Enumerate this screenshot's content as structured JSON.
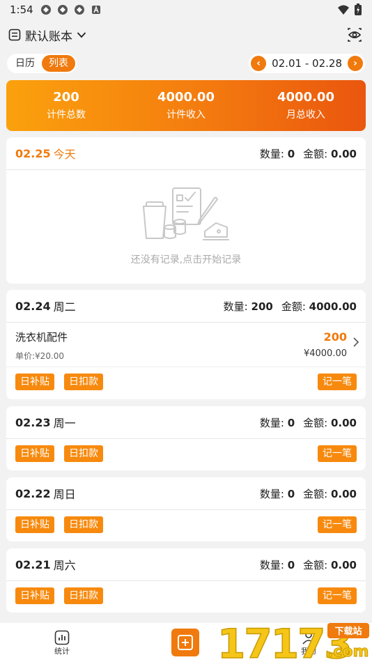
{
  "status_bar": {
    "time": "1:54"
  },
  "header": {
    "ledger_name": "默认账本"
  },
  "view_toggle": {
    "calendar": "日历",
    "list": "列表"
  },
  "range": {
    "label": "02.01 - 02.28"
  },
  "summary": [
    {
      "value": "200",
      "caption": "计件总数"
    },
    {
      "value": "4000.00",
      "caption": "计件收入"
    },
    {
      "value": "4000.00",
      "caption": "月总收入"
    }
  ],
  "labels": {
    "qty_label": "数量:",
    "amount_label": "金额:",
    "daily_subsidy": "日补贴",
    "daily_deduction": "日扣款",
    "record": "记一笔"
  },
  "today": {
    "date": "02.25",
    "weekday": "今天",
    "qty": "0",
    "amount": "0.00",
    "empty_text": "还没有记录,点击开始记录"
  },
  "days": [
    {
      "date": "02.24",
      "weekday": "周二",
      "qty": "200",
      "amount": "4000.00",
      "entry": {
        "name": "洗衣机配件",
        "unit_price": "单价:¥20.00",
        "count": "200",
        "total": "¥4000.00"
      }
    },
    {
      "date": "02.23",
      "weekday": "周一",
      "qty": "0",
      "amount": "0.00"
    },
    {
      "date": "02.22",
      "weekday": "周日",
      "qty": "0",
      "amount": "0.00"
    },
    {
      "date": "02.21",
      "weekday": "周六",
      "qty": "0",
      "amount": "0.00"
    }
  ],
  "bottom_nav": {
    "stats": "统计",
    "mine": "我的"
  },
  "watermark": {
    "text": "17173",
    "badge": "下载站",
    "domain": ".com"
  },
  "colors": {
    "accent": "#f07a0d",
    "banner_start": "#fba10d",
    "banner_end": "#ea560e"
  },
  "icons": [
    "gear-like-status-icon",
    "eye-icon",
    "ledger-icon",
    "chevron-down-icon",
    "chevron-left-icon",
    "chevron-right-icon",
    "empty-illustration",
    "chart-icon",
    "add-icon"
  ]
}
